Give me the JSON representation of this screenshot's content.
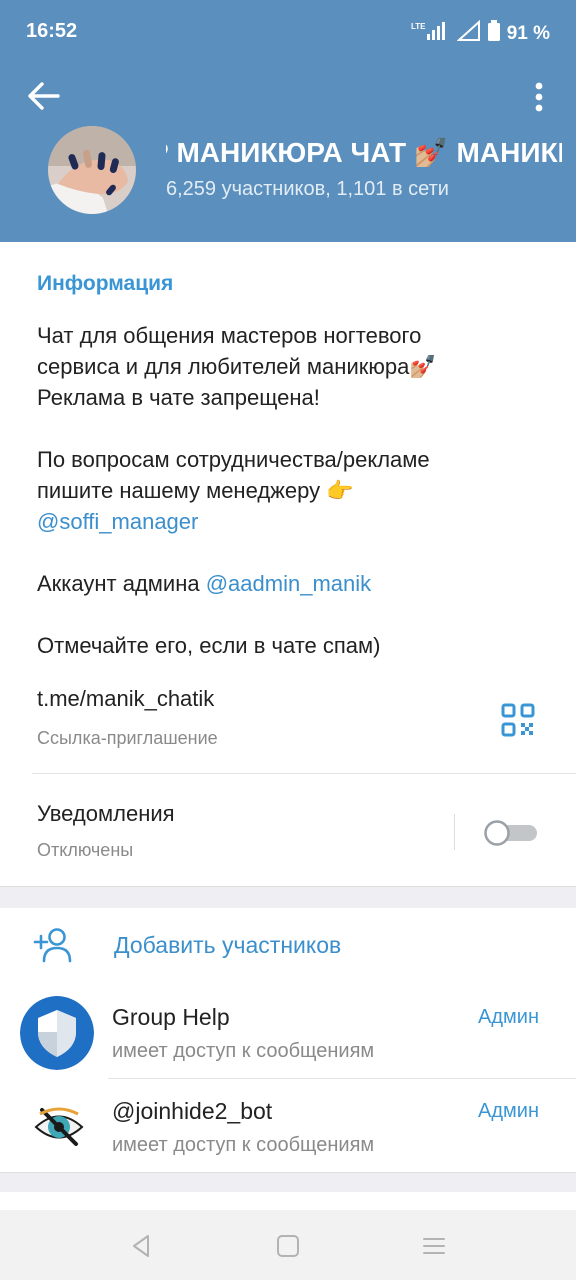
{
  "status_bar": {
    "time": "16:52",
    "network": "LTE",
    "battery": "91 %",
    "icons": [
      "lte-signal-icon",
      "wifi-icon",
      "battery-icon"
    ]
  },
  "header": {
    "back_icon": "arrow-left-icon",
    "more_icon": "vertical-dots-icon",
    "title": "Р МАНИКЮРА ЧАТ 💅🏼   МАНИКЮРА ЧАТ",
    "subtitle": "6,259 участников, 1,101 в сети",
    "color": "#5b8fbd"
  },
  "info": {
    "label": "Информация",
    "description_lines": {
      "l1": "Чат для общения мастеров ногтевого",
      "l2": "сервиса и для любителей маникюра💅🏼",
      "l3": "Реклама в чате запрещена!",
      "l5": "По вопросам сотрудничества/рекламе",
      "l6": "пишите нашему менеджеру 👉",
      "l7": "@soffi_manager",
      "l9_prefix": "Аккаунт админа ",
      "l9_link": "@aadmin_manik",
      "l11": "Отмечайте его, если в чате спам)"
    },
    "invite_link": "t.me/manik_chatik",
    "invite_caption": "Ссылка-приглашение",
    "qr_icon": "qr-code-icon"
  },
  "notifications": {
    "label": "Уведомления",
    "state": "Отключены",
    "enabled": false
  },
  "members": {
    "add_label": "Добавить участников",
    "add_icon": "add-user-icon",
    "list": [
      {
        "name": "Group Help",
        "status": "имеет доступ к сообщениям",
        "role": "Админ",
        "avatar_icon": "shield-icon"
      },
      {
        "name": "@joinhide2_bot",
        "status": "имеет доступ к сообщениям",
        "role": "Админ",
        "avatar_icon": "crossed-eye-icon"
      }
    ]
  },
  "nav": {
    "icons": [
      "back-triangle-icon",
      "home-square-icon",
      "menu-lines-icon"
    ]
  },
  "colors": {
    "accent": "#3a95d5",
    "link": "#3a8fcc",
    "header": "#5b8fbd"
  }
}
